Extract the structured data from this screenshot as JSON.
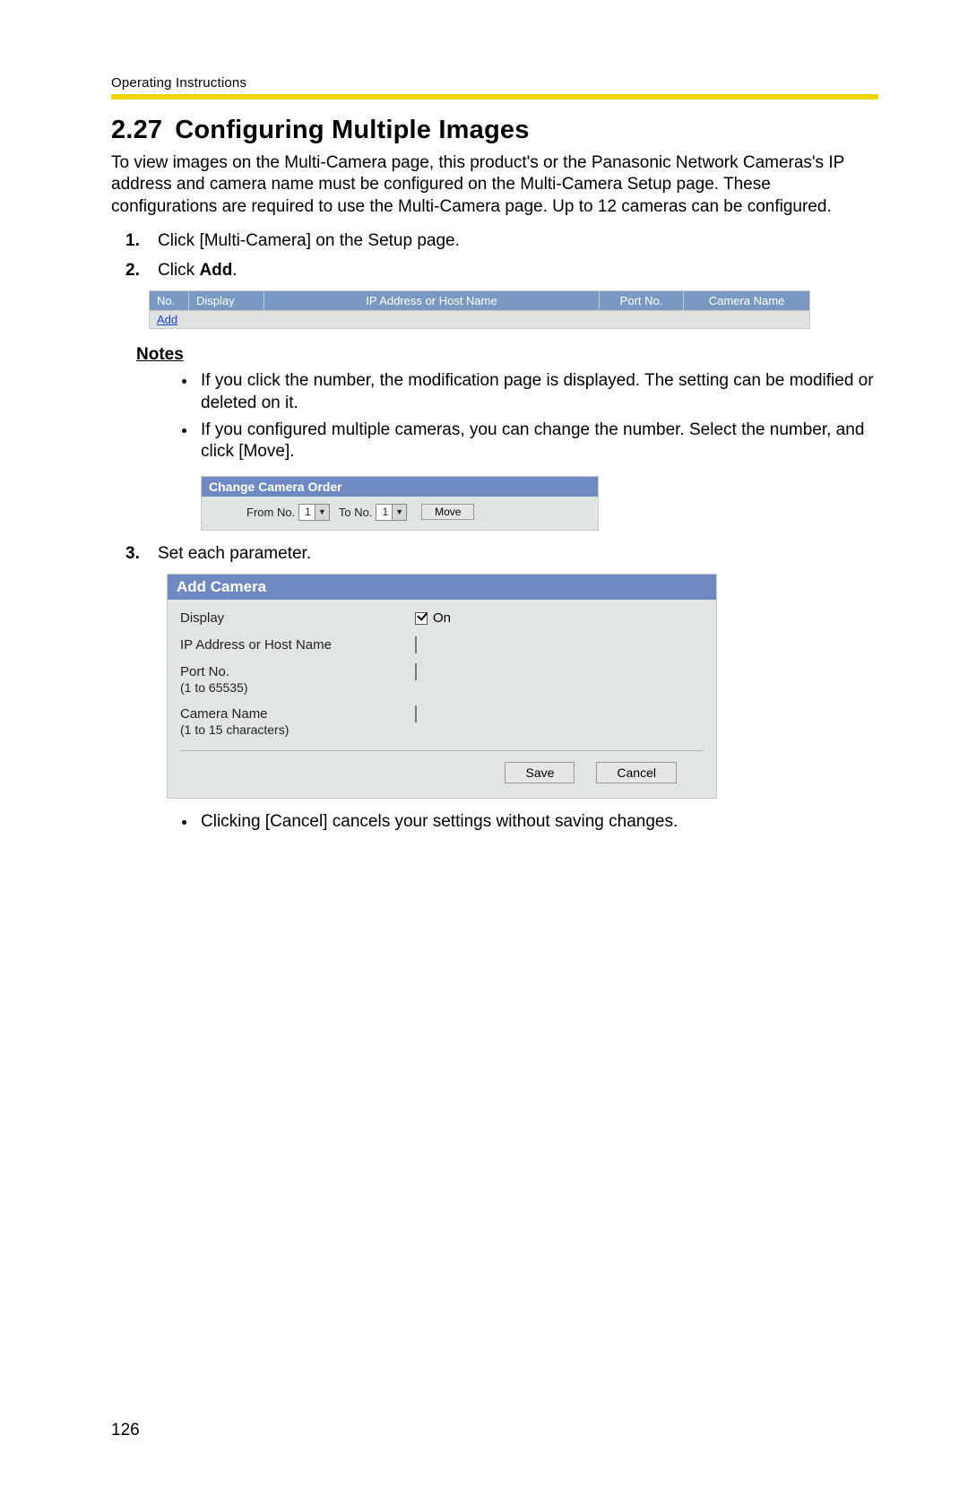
{
  "header": {
    "running_head": "Operating Instructions",
    "section_number": "2.27",
    "section_title": "Configuring Multiple Images"
  },
  "intro": "To view images on the Multi-Camera page, this product's or the Panasonic Network Cameras's IP address and camera name must be configured on the Multi-Camera Setup page. These configurations are required to use the Multi-Camera page. Up to 12 cameras can be configured.",
  "steps": {
    "s1_text": "Click [Multi-Camera] on the Setup page.",
    "s2_pre": "Click ",
    "s2_bold": "Add",
    "s2_post": ".",
    "s3_text": "Set each parameter."
  },
  "table1": {
    "cols": {
      "no": "No.",
      "display": "Display",
      "ip": "IP Address or Host Name",
      "port": "Port No.",
      "camera": "Camera Name"
    },
    "add_link": "Add"
  },
  "notes": {
    "heading": "Notes",
    "n1": "If you click the number, the modification page is displayed. The setting can be modified or deleted on it.",
    "n2": "If you configured multiple cameras, you can change the number. Select the number, and click [Move]."
  },
  "order_panel": {
    "title": "Change Camera Order",
    "from_label": "From No.",
    "to_label": "To No.",
    "from_value": "1",
    "to_value": "1",
    "move_btn": "Move"
  },
  "addcam": {
    "title": "Add Camera",
    "rows": {
      "display_label": "Display",
      "display_value": "On",
      "ip_label": "IP Address or Host Name",
      "port_label": "Port No.",
      "port_sub": "(1 to 65535)",
      "name_label": "Camera Name",
      "name_sub": "(1 to 15 characters)"
    },
    "save_btn": "Save",
    "cancel_btn": "Cancel"
  },
  "post_note": "Clicking [Cancel] cancels your settings without saving changes.",
  "page_number": "126"
}
